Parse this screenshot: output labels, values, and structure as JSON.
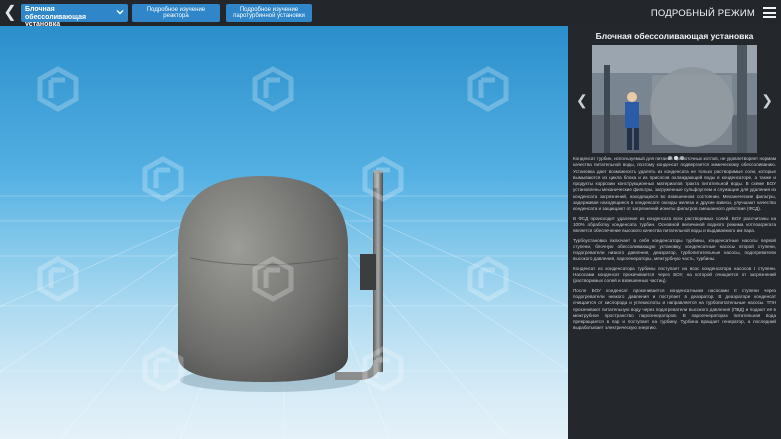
{
  "header": {
    "back_icon": "chevron-left-icon",
    "select": {
      "value": "Блочная обессоливающая установка"
    },
    "buttons": [
      {
        "label": "Подробное изучение реактора"
      },
      {
        "label": "Подробное изучение паротурбинной установки"
      }
    ],
    "mode_title": "ПОДРОБНЫЙ РЕЖИМ",
    "menu_icon": "hamburger-menu-icon"
  },
  "viewport": {
    "object": "Блочная обессоливающая установка (3D-модель)",
    "watermark_icon": "logo-watermark-icon"
  },
  "panel": {
    "title": "Блочная обессоливающая установка",
    "carousel": {
      "slides": 3,
      "active": 1
    },
    "paragraphs": [
      "Конденсат турбин, используемый для питания прямоточных котлов, не удовлетворяет нормам качества питательной воды, поэтому конденсат подвергается химическому обессоливанию. Установка дает возможность удалять из конденсата не только растворимые соли, которые вымываются из цикла блока и из присосов охлаждающей воды в конденсаторе, а также и продукты коррозии конструкционных материалов тракта питательной воды. В схеме БОУ установлены механические фильтры, загруженные сульфоуглем и служащие для удаления из конденсата загрязнений, находящихся во взвешенном состоянии. Механические фильтры, задерживая находящиеся в конденсате оксиды железа и другие взвеси, улучшают качество конденсата и защищают от загрязнений иониты фильтров смешанного действия (ФСД).",
      "В ФСД происходит удаление из конденсата всех растворимых солей. БОУ рассчитаны на 100% обработку конденсата турбин. Основной величиной водного режима котлоагрегата является обеспечение высокого качества питательной воды и выдаваемого им пара.",
      "Турбоустановка включает в себя конденсаторы турбины, конденсатные насосы первой ступени, блочную обессоливающую установку, конденсатные насосы второй ступени, подогреватели низкого давления, деаэратор, турбопитательные насосы, подогреватели высокого давления, парогенераторы, межтурбную часть, турбины.",
      "Конденсат из конденсатора турбины поступает на всас конденсатора насосов I ступени. Насосами конденсат прокачивается через БОУ, на которой очищается от загрязнений (растворимых солей и взвешенных частиц).",
      "После БОУ конденсат прокачивается конденсатными насосами II ступени через подогреватели низкого давления и поступает в деаэратор. В деаэраторе конденсат очищается от кислорода и углекислоты и направляется на турбопитательные насосы. ТПН прокачивают питательную воду через подогреватели высокого давления (ПВД) и подают её в межтрубное пространство парогенераторов. В парогенераторах питательная вода превращается в пар и поступает на турбину. Турбина вращает генератор, а последний вырабатывает электрическую энергию."
    ]
  }
}
